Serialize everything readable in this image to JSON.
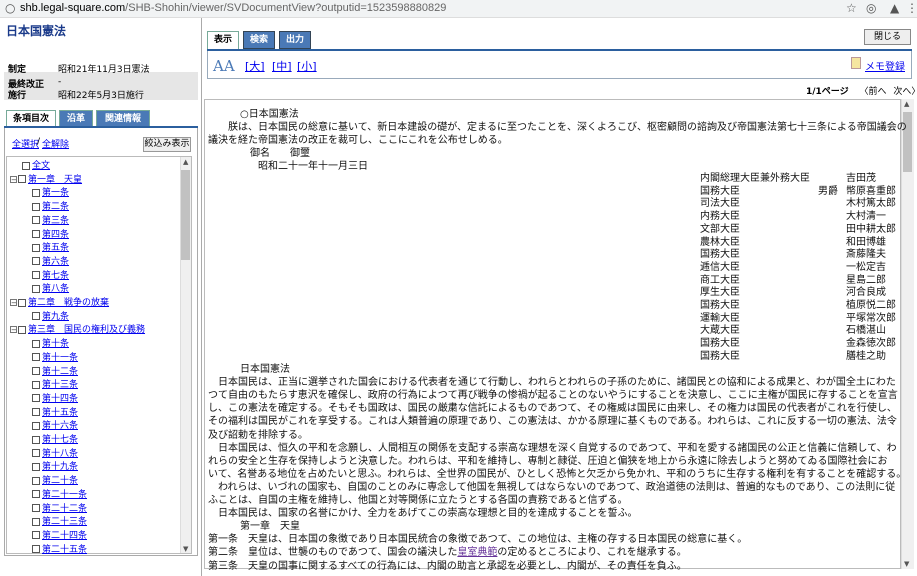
{
  "browser": {
    "url_domain": "shb.legal-square.com",
    "url_rest": "/SHB-Shohin/viewer/SVDocumentView?outputid=1523598880829"
  },
  "left": {
    "title": "日本国憲法",
    "meta": [
      {
        "label": "制定",
        "value": "昭和21年11月3日憲法"
      },
      {
        "label": "最終改正",
        "value": "-"
      },
      {
        "label": "施行",
        "value": "昭和22年5月3日施行"
      }
    ],
    "tabs": [
      "条項目次",
      "沿革",
      "関連情報"
    ],
    "select_all": "全選択",
    "deselect_all": "全解除",
    "narrow_button": "絞込み表示",
    "toc": [
      {
        "label": "全文",
        "indent": 1
      },
      {
        "label": "第一章　天皇",
        "indent": 0,
        "toggle": "−"
      },
      {
        "label": "第一条",
        "indent": 2
      },
      {
        "label": "第二条",
        "indent": 2
      },
      {
        "label": "第三条",
        "indent": 2
      },
      {
        "label": "第四条",
        "indent": 2
      },
      {
        "label": "第五条",
        "indent": 2
      },
      {
        "label": "第六条",
        "indent": 2
      },
      {
        "label": "第七条",
        "indent": 2
      },
      {
        "label": "第八条",
        "indent": 2
      },
      {
        "label": "第二章　戦争の放棄",
        "indent": 0,
        "toggle": "−"
      },
      {
        "label": "第九条",
        "indent": 2
      },
      {
        "label": "第三章　国民の権利及び義務",
        "indent": 0,
        "toggle": "−"
      },
      {
        "label": "第十条",
        "indent": 2
      },
      {
        "label": "第十一条",
        "indent": 2
      },
      {
        "label": "第十二条",
        "indent": 2
      },
      {
        "label": "第十三条",
        "indent": 2
      },
      {
        "label": "第十四条",
        "indent": 2
      },
      {
        "label": "第十五条",
        "indent": 2
      },
      {
        "label": "第十六条",
        "indent": 2
      },
      {
        "label": "第十七条",
        "indent": 2
      },
      {
        "label": "第十八条",
        "indent": 2
      },
      {
        "label": "第十九条",
        "indent": 2
      },
      {
        "label": "第二十条",
        "indent": 2
      },
      {
        "label": "第二十一条",
        "indent": 2
      },
      {
        "label": "第二十二条",
        "indent": 2
      },
      {
        "label": "第二十三条",
        "indent": 2
      },
      {
        "label": "第二十四条",
        "indent": 2
      },
      {
        "label": "第二十五条",
        "indent": 2
      }
    ]
  },
  "right": {
    "tabs": [
      "表示",
      "検索",
      "出力"
    ],
    "close_button": "閉じる",
    "aa": "AA",
    "font_sizes": [
      "[大]",
      "[中]",
      "[小]"
    ],
    "memo": "メモ登録",
    "page_label": "1/1ページ",
    "prev": "〈前へ",
    "next": "次へ〉",
    "lines": [
      "○日本国憲法",
      "　朕は、日本国民の総意に基いて、新日本建設の礎が、定まるに至つたことを、深くよろこび、枢密顧問の諮詢及び帝国憲法第七十三条による帝国議会の",
      "議決を経た帝国憲法の改正を裁可し、ここにこれを公布せしめる。",
      "御名　　御璽",
      "昭和二十一年十一月三日"
    ],
    "signers": [
      {
        "title": "内閣総理大臣兼外務大臣",
        "extra": "",
        "name": "吉田茂"
      },
      {
        "title": "国務大臣",
        "extra": "男爵",
        "name": "幣原喜重郎"
      },
      {
        "title": "司法大臣",
        "extra": "",
        "name": "木村篤太郎"
      },
      {
        "title": "内務大臣",
        "extra": "",
        "name": "大村清一"
      },
      {
        "title": "文部大臣",
        "extra": "",
        "name": "田中耕太郎"
      },
      {
        "title": "農林大臣",
        "extra": "",
        "name": "和田博雄"
      },
      {
        "title": "国務大臣",
        "extra": "",
        "name": "斎藤隆夫"
      },
      {
        "title": "逓信大臣",
        "extra": "",
        "name": "一松定吉"
      },
      {
        "title": "商工大臣",
        "extra": "",
        "name": "星島二郎"
      },
      {
        "title": "厚生大臣",
        "extra": "",
        "name": "河合良成"
      },
      {
        "title": "国務大臣",
        "extra": "",
        "name": "植原悦二郎"
      },
      {
        "title": "運輸大臣",
        "extra": "",
        "name": "平塚常次郎"
      },
      {
        "title": "大蔵大臣",
        "extra": "",
        "name": "石橋湛山"
      },
      {
        "title": "国務大臣",
        "extra": "",
        "name": "金森徳次郎"
      },
      {
        "title": "国務大臣",
        "extra": "",
        "name": "膳桂之助"
      }
    ],
    "body": [
      "日本国憲法",
      "　日本国民は、正当に選挙された国会における代表者を通じて行動し、われらとわれらの子孫のために、諸国民との協和による成果と、わが国全土にわた",
      "つて自由のもたらす恵沢を確保し、政府の行為によつて再び戦争の惨禍が起ることのないやうにすることを決意し、ここに主権が国民に存することを宣言",
      "し、この憲法を確定する。そもそも国政は、国民の厳粛な信託によるものであつて、その権威は国民に由来し、その権力は国民の代表者がこれを行使し、",
      "その福利は国民がこれを享受する。これは人類普遍の原理であり、この憲法は、かかる原理に基くものである。われらは、これに反する一切の憲法、法令",
      "及び詔勅を排除する。",
      "　日本国民は、恒久の平和を念願し、人間相互の関係を支配する崇高な理想を深く自覚するのであつて、平和を愛する諸国民の公正と信義に信頼して、わ",
      "れらの安全と生存を保持しようと決意した。われらは、平和を維持し、専制と隷従、圧迫と偏狭を地上から永遠に除去しようと努めてゐる国際社会にお",
      "いて、名誉ある地位を占めたいと思ふ。われらは、全世界の国民が、ひとしく恐怖と欠乏から免かれ、平和のうちに生存する権利を有することを確認する。",
      "　われらは、いづれの国家も、自国のことのみに専念して他国を無視してはならないのであつて、政治道徳の法則は、普遍的なものであり、この法則に従",
      "ふことは、自国の主権を維持し、他国と対等関係に立たうとする各国の責務であると信ずる。",
      "　日本国民は、国家の名誉にかけ、全力をあげてこの崇高な理想と目的を達成することを誓ふ。",
      "第一章　天皇",
      "第一条　天皇は、日本国の象徴であり日本国民統合の象徴であつて、この地位は、主権の存する日本国民の総意に基く。",
      "第二条　皇位は、世襲のものであつて、国会の議決した",
      "皇室典範",
      "の定めるところにより、これを継承する。",
      "第三条　天皇の国事に関するすべての行為には、内閣の助言と承認を必要とし、内閣が、その責任を負ふ。"
    ]
  }
}
